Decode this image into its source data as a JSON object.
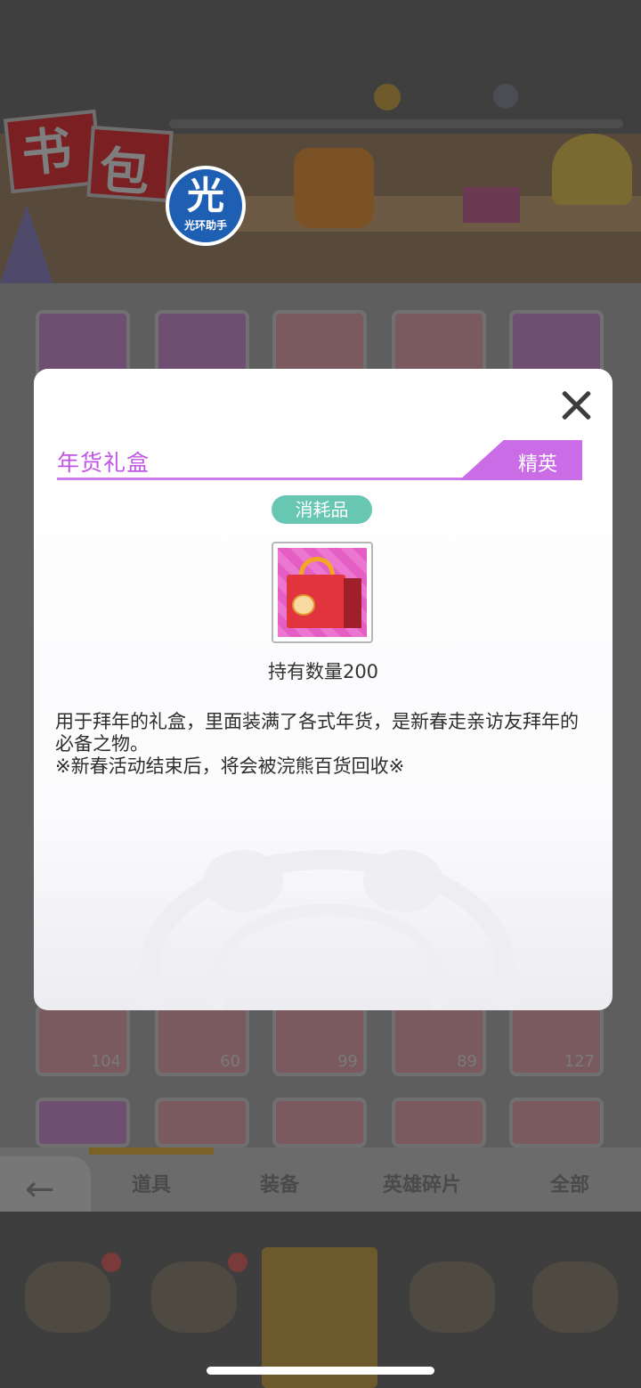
{
  "background": {
    "title_chars": [
      "书",
      "包"
    ],
    "watermark": {
      "big": "光",
      "small": "光环助手"
    },
    "tile_counts": [
      "104",
      "60",
      "99",
      "89",
      "127"
    ],
    "tabs": [
      "道具",
      "装备",
      "英雄碎片",
      "全部"
    ],
    "back_label": "返回"
  },
  "dialog": {
    "item_name": "年货礼盒",
    "rarity": "精英",
    "type": "消耗品",
    "holding": "持有数量200",
    "description": [
      "用于拜年的礼盒，里面装满了各式年货，是新春走亲访友拜年的必备之物。",
      "※新春活动结束后，将会被浣熊百货回收※"
    ],
    "item_icon": "gift-bag-icon"
  },
  "colors": {
    "title_purple": "#c155e6",
    "rarity_purple": "#c96ce6",
    "type_teal": "#67c7b2"
  }
}
